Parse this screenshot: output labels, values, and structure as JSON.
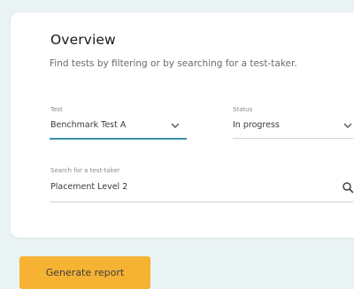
{
  "overview": {
    "title": "Overview",
    "subtitle": "Find tests by filtering or by searching for a test-taker."
  },
  "filters": {
    "test": {
      "label": "Test",
      "value": "Benchmark Test A",
      "icon": "chevron-down-icon"
    },
    "status": {
      "label": "Status",
      "value": "In progress",
      "icon": "chevron-down-icon"
    }
  },
  "search": {
    "label": "Search for a test-taker",
    "value": "Placement Level 2",
    "icon": "search-icon"
  },
  "actions": {
    "generate_report": "Generate report"
  },
  "colors": {
    "page_background": "#eaf3f3",
    "card_background": "#ffffff",
    "accent": "#3a8fa3",
    "button": "#f5b233"
  }
}
